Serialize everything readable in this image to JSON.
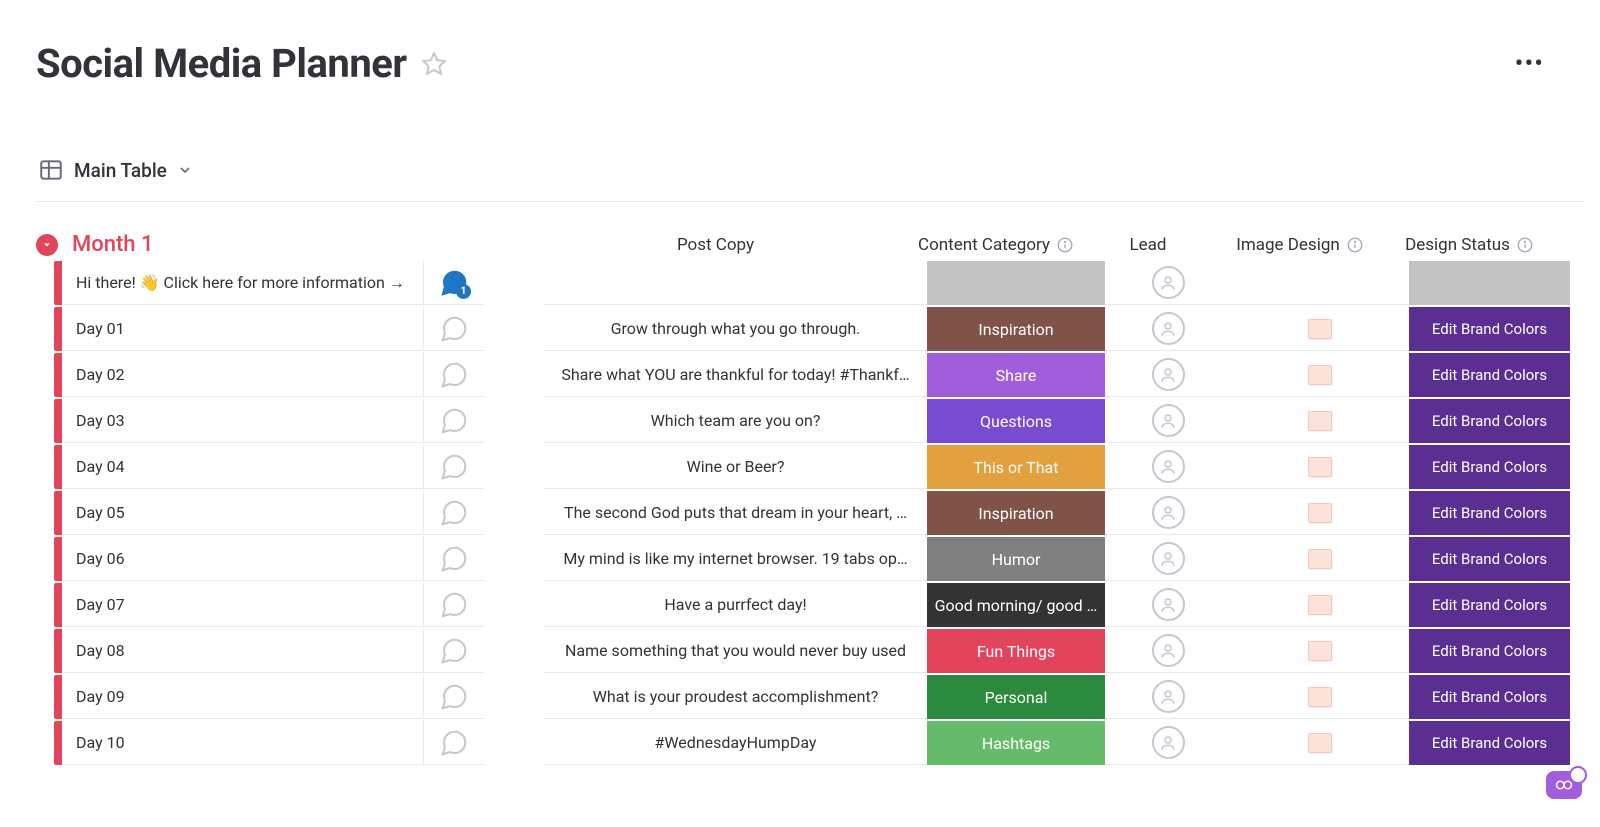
{
  "header": {
    "title": "Social Media Planner"
  },
  "view": {
    "name": "Main Table"
  },
  "group": {
    "name": "Month 1",
    "accent": "#e2445c"
  },
  "columns": {
    "postCopy": "Post Copy",
    "contentCategory": "Content Category",
    "lead": "Lead",
    "imageDesign": "Image Design",
    "designStatus": "Design Status"
  },
  "categoryColors": {
    "Inspiration": "#7f5347",
    "Share": "#a25ddc",
    "Questions": "#784bd1",
    "This or That": "#e2a03f",
    "Humor": "#808080",
    "Good morning/ good …": "#333333",
    "Fun Things": "#e2445c",
    "Personal": "#2b8a3e",
    "Hashtags": "#66bb6a",
    "": "#c4c4c4"
  },
  "rows": [
    {
      "name": "Hi there! 👋 Click here for more information →",
      "postCopy": "",
      "category": "",
      "designStatus": "",
      "hasThumb": false,
      "commentActive": true,
      "commentCount": "1"
    },
    {
      "name": "Day 01",
      "postCopy": "Grow through what you go through.",
      "category": "Inspiration",
      "designStatus": "Edit Brand Colors",
      "hasThumb": true,
      "commentActive": false
    },
    {
      "name": "Day 02",
      "postCopy": "Share what YOU are thankful for today! #Thankf…",
      "category": "Share",
      "designStatus": "Edit Brand Colors",
      "hasThumb": true,
      "commentActive": false
    },
    {
      "name": "Day 03",
      "postCopy": "Which team are you on?",
      "category": "Questions",
      "designStatus": "Edit Brand Colors",
      "hasThumb": true,
      "commentActive": false
    },
    {
      "name": "Day 04",
      "postCopy": "Wine or Beer?",
      "category": "This or That",
      "designStatus": "Edit Brand Colors",
      "hasThumb": true,
      "commentActive": false
    },
    {
      "name": "Day 05",
      "postCopy": "The second God puts that dream in your heart, …",
      "category": "Inspiration",
      "designStatus": "Edit Brand Colors",
      "hasThumb": true,
      "commentActive": false
    },
    {
      "name": "Day 06",
      "postCopy": "My mind is like my internet browser. 19 tabs op…",
      "category": "Humor",
      "designStatus": "Edit Brand Colors",
      "hasThumb": true,
      "commentActive": false
    },
    {
      "name": "Day 07",
      "postCopy": "Have a purrfect day!",
      "category": "Good morning/ good …",
      "designStatus": "Edit Brand Colors",
      "hasThumb": true,
      "commentActive": false
    },
    {
      "name": "Day 08",
      "postCopy": "Name something that you would never buy used",
      "category": "Fun Things",
      "designStatus": "Edit Brand Colors",
      "hasThumb": true,
      "commentActive": false
    },
    {
      "name": "Day 09",
      "postCopy": "What is your proudest accomplishment?",
      "category": "Personal",
      "designStatus": "Edit Brand Colors",
      "hasThumb": true,
      "commentActive": false
    },
    {
      "name": "Day 10",
      "postCopy": "#WednesdayHumpDay",
      "category": "Hashtags",
      "designStatus": "Edit Brand Colors",
      "hasThumb": true,
      "commentActive": false
    }
  ]
}
